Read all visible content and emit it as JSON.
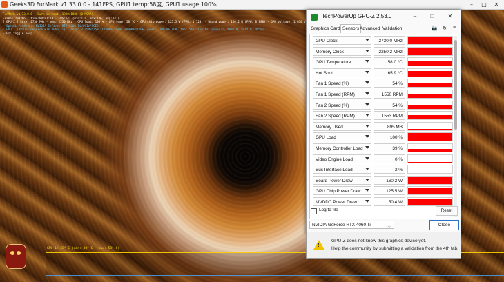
{
  "furmark": {
    "window_title": "Geeks3D FurMark v1.33.0.0 - 141FPS, GPU1 temp:58度, GPU1 usage:100%",
    "controls": {
      "minimize": "–",
      "maximize": "□",
      "close": "✕"
    },
    "hud_lines": [
      {
        "text": "FurMark v1.33.0.0 - Burn-in test, 1920x1080 (0 MSAA)",
        "color": "y"
      },
      {
        "text": "Frames:200266 - time:00:01:19 - FPS:141 (min:124, max:146, avg:142)",
        "color": "w"
      },
      {
        "text": "[ GPU-Z ] core: 2730 MHz - mem: 2250 MHz - GPU load: 100 % - GPU temp: 58 °C - GPU chip power: 125.5 W (PPW: 1.123) - Board power: 160.2 W (PPW: 0.880) - GPU voltage: 1.050 V",
        "color": "w"
      },
      {
        "text": "- OpenGL renderer: NVIDIA GeForce RTX 4060 Ti/PCIe/SSE2",
        "color": "c"
      },
      {
        "text": "- GPU 1 (NVIDIA GeForce RTX 4060 Ti) - core: 2745MHz/58 °C/100%, mem: 8999MHz/10%, power: 100.0% TDP, fan: 54%, limits:[power:1, temp:0, volt:0, OV:0]",
        "color": "c"
      },
      {
        "text": "- F1: toggle help",
        "color": "w"
      }
    ],
    "temp_graph_label": "GPU 1: 58° C (min: 38° C - max: 58° C)"
  },
  "gpuz": {
    "title": "TechPowerUp GPU-Z 2.53.0",
    "controls": {
      "minimize": "–",
      "maximize": "□",
      "close": "✕"
    },
    "tabs": [
      "Graphics Card",
      "Sensors",
      "Advanced",
      "Validation"
    ],
    "active_tab": "Sensors",
    "tool_icons": {
      "camera": "📷",
      "refresh": "↻",
      "menu": "≡"
    },
    "sensors": [
      {
        "name": "GPU Clock",
        "value": "2730.0 MHz",
        "fill": 0.95
      },
      {
        "name": "Memory Clock",
        "value": "2250.2 MHz",
        "fill": 0.95
      },
      {
        "name": "GPU Temperature",
        "value": "58.0 °C",
        "fill": 0.6
      },
      {
        "name": "Hot Spot",
        "value": "65.9 °C",
        "fill": 0.7
      },
      {
        "name": "Fan 1 Speed (%)",
        "value": "54 %",
        "fill": 0.54
      },
      {
        "name": "Fan 1 Speed (RPM)",
        "value": "1550 RPM",
        "fill": 0.54
      },
      {
        "name": "Fan 2 Speed (%)",
        "value": "54 %",
        "fill": 0.54
      },
      {
        "name": "Fan 2 Speed (RPM)",
        "value": "1553 RPM",
        "fill": 0.54
      },
      {
        "name": "Memory Used",
        "value": "895 MB",
        "fill": 0.12
      },
      {
        "name": "GPU Load",
        "value": "100 %",
        "fill": 1.0
      },
      {
        "name": "Memory Controller Load",
        "value": "39 %",
        "fill": 0.39
      },
      {
        "name": "Video Engine Load",
        "value": "0 %",
        "fill": 0.0
      },
      {
        "name": "Bus Interface Load",
        "value": "2 %",
        "fill": 0.05
      },
      {
        "name": "Board Power Draw",
        "value": "160.2 W",
        "fill": 0.9
      },
      {
        "name": "GPU Chip Power Draw",
        "value": "125.5 W",
        "fill": 0.85
      },
      {
        "name": "MVDDC Power Draw",
        "value": "50.4 W",
        "fill": 0.8
      }
    ],
    "log_to_file_label": "Log to file",
    "log_to_file_checked": false,
    "reset_label": "Reset",
    "gpu_select_value": "NVIDIA GeForce RTX 4060 Ti",
    "close_label": "Close",
    "notice_line1": "GPU-Z does not know this graphics device yet.",
    "notice_line2": "Help the community by submitting a validation from the 4th tab.",
    "graph_color": "#ff0000"
  }
}
